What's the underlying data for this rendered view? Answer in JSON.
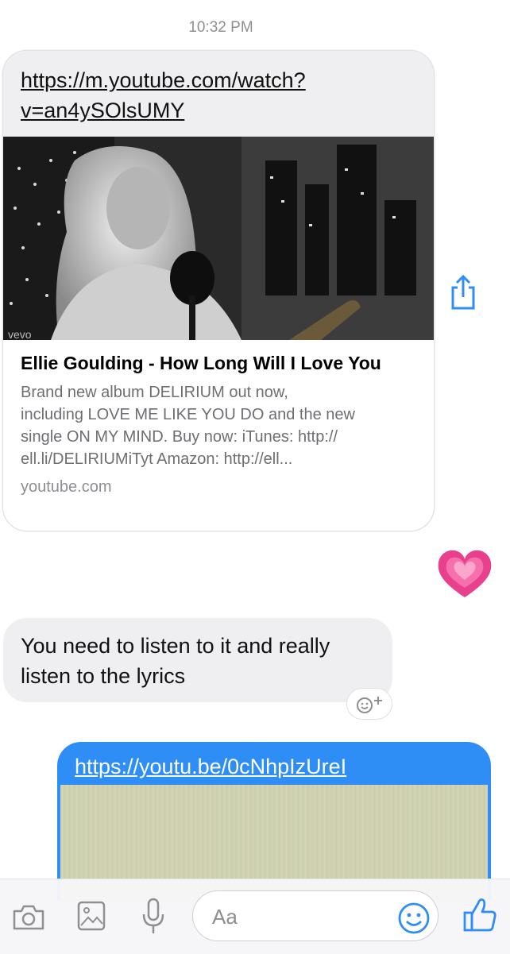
{
  "thread": {
    "timestamp": "10:32 PM",
    "messages": [
      {
        "url": "https://m.youtube.com/watch?v=an4ySOlsUMY",
        "url_line1": "https://m.youtube.com/watch?",
        "url_line2": "v=an4ySOlsUMY",
        "card_title": "Ellie Goulding - How Long Will I Love You",
        "card_desc_lines": [
          "Brand new album DELIRIUM out now,",
          "including LOVE ME LIKE YOU DO and the new",
          "single ON MY MIND. Buy now: iTunes: http://",
          "ell.li/DELIRIUMiTyt Amazon: http://ell..."
        ],
        "card_domain": "youtube.com"
      },
      {
        "text_lines": [
          "You need to listen to it and really",
          "listen to the lyrics"
        ]
      },
      {
        "url": "https://youtu.be/0cNhpIzUreI"
      }
    ]
  },
  "composer": {
    "placeholder": "Aa",
    "icons": [
      "camera-icon",
      "image-icon",
      "microphone-icon",
      "emoji-icon",
      "thumbs-up-icon"
    ],
    "accent": "#2e8ef5"
  },
  "heart_color": "#e8408c"
}
